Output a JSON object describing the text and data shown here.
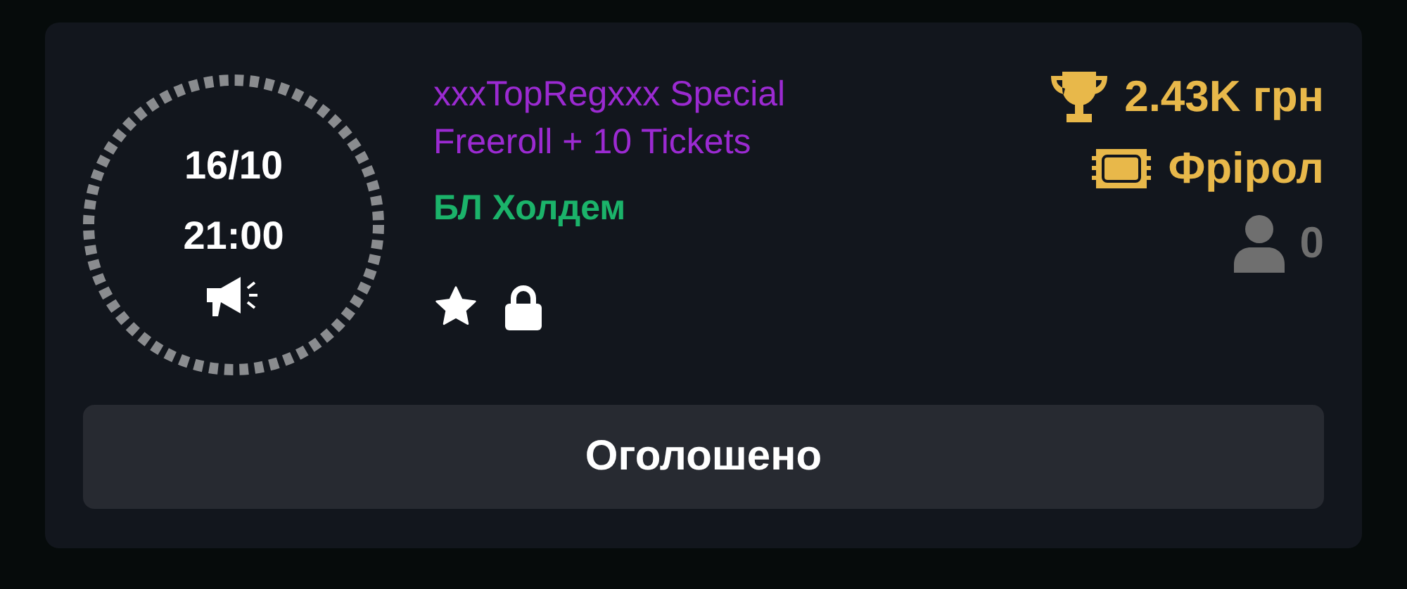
{
  "tournament": {
    "date": "16/10",
    "time": "21:00",
    "title": "xxxTopRegxxx Special Freeroll + 10 Tickets",
    "game": "БЛ Холдем",
    "prize": "2.43K грн",
    "buy_in": "Фрірол",
    "players": "0"
  },
  "status_button": {
    "label": "Оголошено"
  }
}
